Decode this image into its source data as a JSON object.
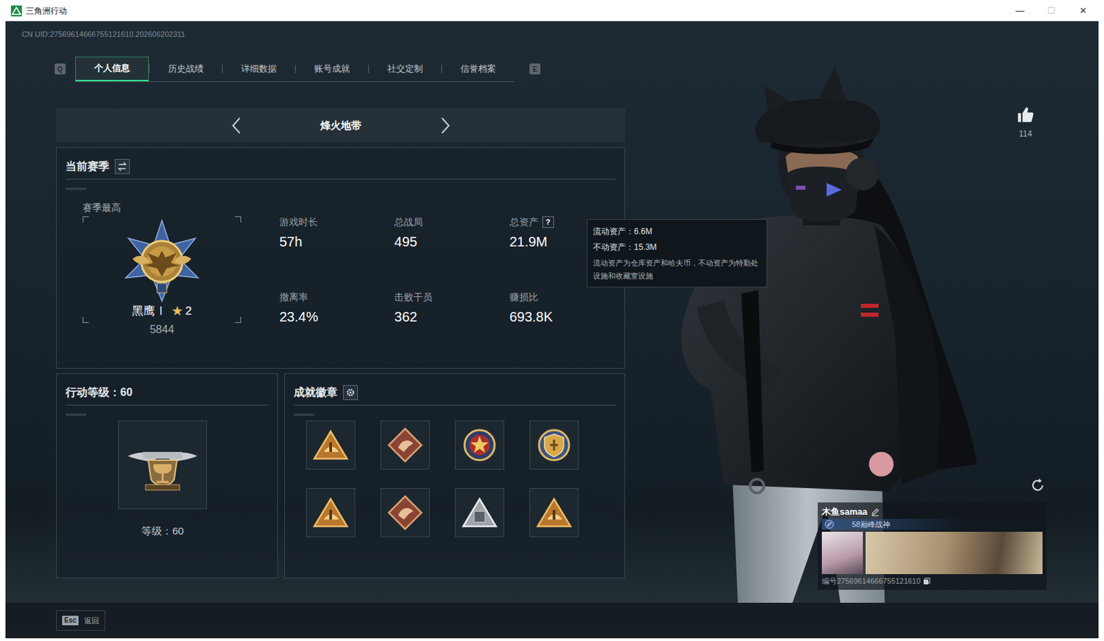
{
  "window": {
    "title": "三角洲行动",
    "controls": [
      {
        "label": "—",
        "disabled": false
      },
      {
        "label": "☐",
        "disabled": true
      },
      {
        "label": "✕",
        "disabled": false
      }
    ]
  },
  "uid": "CN UID:27569614666755121610.202606202311",
  "tabs": {
    "prev_key": "Q",
    "next_key": "E",
    "items": [
      {
        "label": "个人信息",
        "selected": true
      },
      {
        "label": "历史战绩",
        "selected": false
      },
      {
        "label": "详细数据",
        "selected": false
      },
      {
        "label": "账号成就",
        "selected": false
      },
      {
        "label": "社交定制",
        "selected": false
      },
      {
        "label": "信誉档案",
        "selected": false
      }
    ]
  },
  "mode": {
    "label": "烽火地带"
  },
  "season": {
    "title": "当前赛季",
    "best_label": "赛季最高",
    "rank": "黑鹰Ⅰ",
    "star": "★",
    "star_count": "2",
    "score": "5844",
    "stats": [
      {
        "label": "游戏时长",
        "value": "57h"
      },
      {
        "label": "总战局",
        "value": "495"
      },
      {
        "label": "总资产",
        "value": "21.9M",
        "help": "?"
      },
      {
        "label": "撤离率",
        "value": "23.4%"
      },
      {
        "label": "击败干员",
        "value": "362"
      },
      {
        "label": "赚损比",
        "value": "693.8K"
      }
    ]
  },
  "tooltip": {
    "lines": [
      "流动资产：6.6M",
      "不动资产：15.3M"
    ],
    "note": "流动资产为仓库资产和哈夫币，不动资产为特勤处设施和收藏室设施"
  },
  "level": {
    "title": "行动等级：60",
    "caption": "等级：60"
  },
  "badges": {
    "title": "成就徽章",
    "items": [
      {
        "kind": "gold-triangle"
      },
      {
        "kind": "diamond"
      },
      {
        "kind": "star-medal"
      },
      {
        "kind": "shield-medal"
      },
      {
        "kind": "gold-triangle"
      },
      {
        "kind": "diamond"
      },
      {
        "kind": "silver-triangle"
      },
      {
        "kind": "gold-triangle"
      }
    ]
  },
  "likes": {
    "count": "114"
  },
  "player": {
    "name": "木鱼samaa",
    "title": "58巅峰战神",
    "id": "编号27569614666755121610"
  },
  "footer": {
    "key": "Esc",
    "label": "返回"
  }
}
